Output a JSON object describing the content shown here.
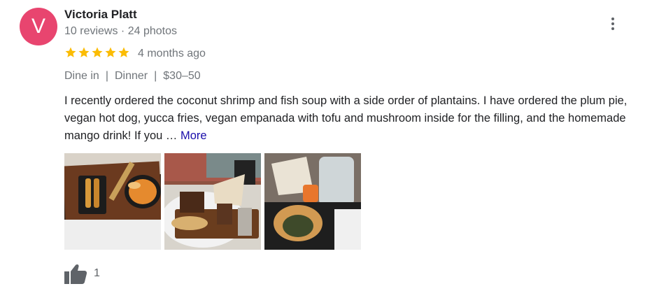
{
  "reviewer": {
    "initial": "V",
    "name": "Victoria Platt",
    "meta": "10 reviews · 24 photos",
    "avatar_color": "#e8456f"
  },
  "rating": {
    "stars": 5,
    "max": 5,
    "star_color": "#fbbc04"
  },
  "time_ago": "4 months ago",
  "tags": [
    "Dine in",
    "Dinner",
    "$30–50"
  ],
  "tag_separator": "|",
  "review_text": "I recently ordered the coconut shrimp and fish soup with a side order of plantains. I have ordered the plum pie, vegan hot dog, yucca fries, vegan empanada with tofu and mushroom inside for the filling, and the homemade mango drink! If you …",
  "more_label": "More",
  "photos": [
    "photo-plantains-soup",
    "photo-hotdog-fries",
    "photo-empanada-drink"
  ],
  "likes": {
    "count": "1",
    "icon": "thumbs-up-icon"
  },
  "menu_icon": "more-vert-icon"
}
